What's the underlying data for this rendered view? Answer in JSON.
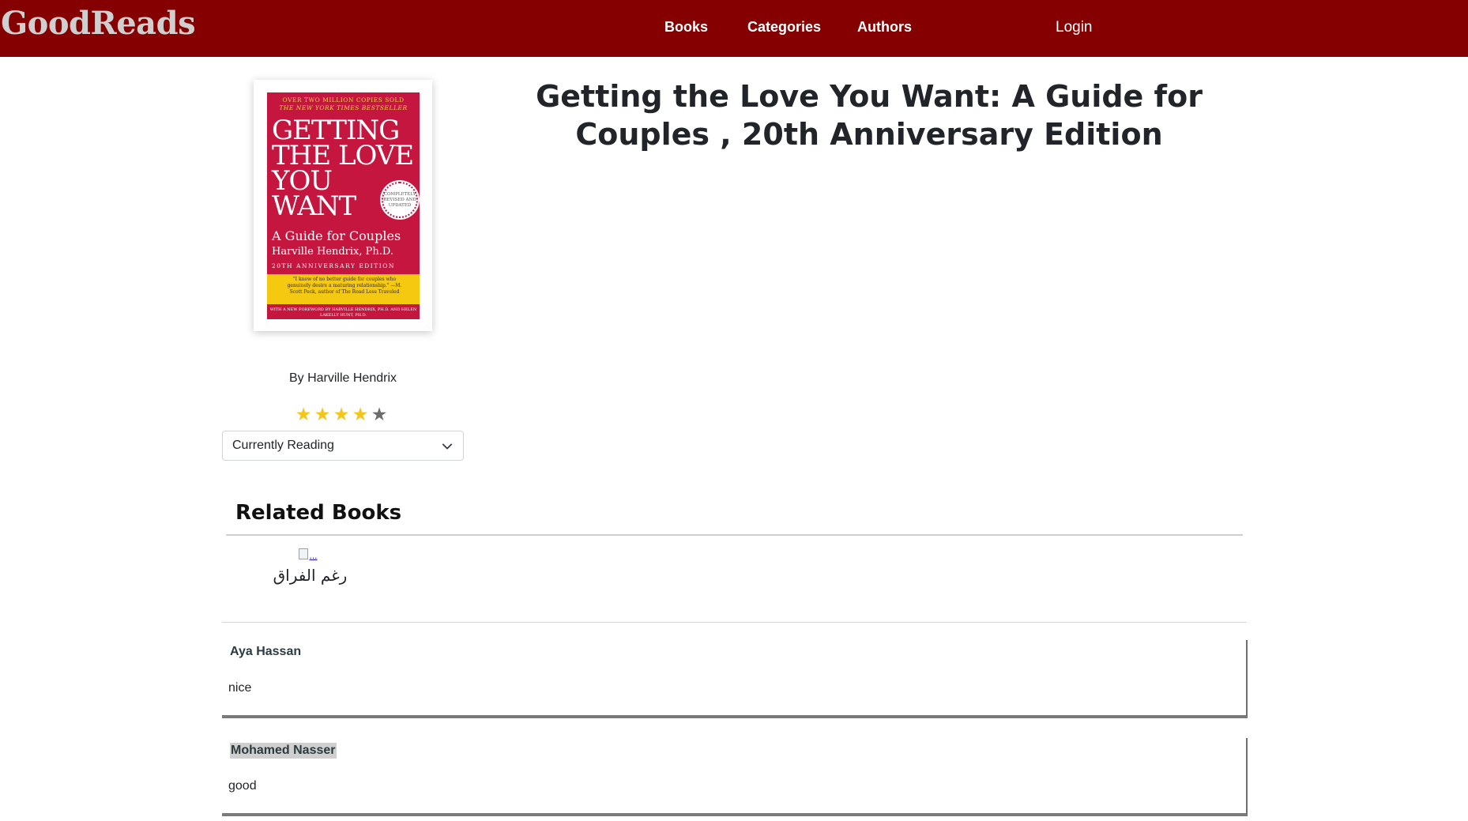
{
  "navbar": {
    "brand": "GoodReads",
    "links": [
      "Books",
      "Categories",
      "Authors"
    ],
    "login": "Login"
  },
  "book": {
    "title": "Getting the Love You Want: A Guide for Couples , 20th Anniversary Edition",
    "byline": "By Harville Hendrix",
    "rating": {
      "value": 4,
      "max": 5
    },
    "shelf_select": "Currently Reading",
    "cover": {
      "banner_line1": "OVER TWO MILLION COPIES SOLD",
      "banner_line2": "THE NEW YORK TIMES BESTSELLER",
      "big_title": "GETTING THE LOVE YOU WANT",
      "subtitle": "A Guide for Couples",
      "author": "Harville Hendrix, Ph.D.",
      "edition": "20TH ANNIVERSARY EDITION",
      "seal": "COMPLETELY REVISED AND UPDATED",
      "quote": "\"I know of no better guide for couples who genuinely desire a maturing relationship.\" —M. Scott Peck, author of The Road Less Traveled",
      "foreword": "WITH A NEW FOREWORD BY HARVILLE HENDRIX, PH.D. AND HELEN LAKELLY HUNT, PH.D."
    }
  },
  "related": {
    "heading": "Related Books",
    "items": [
      {
        "img_alt": "...",
        "title": "رغم الفراق"
      }
    ]
  },
  "reviews": [
    {
      "name": "Aya Hassan",
      "comment": "nice"
    },
    {
      "name": "Mohamed Nasser",
      "comment": "good"
    }
  ],
  "colors": {
    "navbar": "#850000",
    "star_filled": "#f5c518",
    "star_empty": "#6c6c6c",
    "cover_red": "#c4163f",
    "cover_yellow": "#f5c90f"
  }
}
